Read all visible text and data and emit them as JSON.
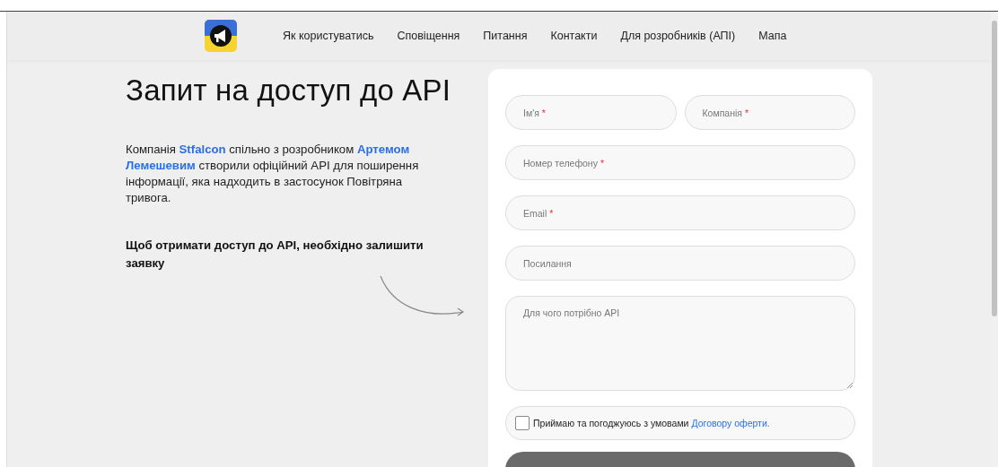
{
  "nav": {
    "items": [
      {
        "label": "Як користуватись"
      },
      {
        "label": "Сповіщення"
      },
      {
        "label": "Питання"
      },
      {
        "label": "Контакти"
      },
      {
        "label": "Для розробників (АПІ)"
      },
      {
        "label": "Мапа"
      }
    ]
  },
  "intro": {
    "title": "Запит на доступ до API",
    "paragraph": "Компанія **Stfalcon** спільно з розробником **Артемом Лемешевим** створили офіційний API для поширення інформації, яка надходить в застосунок Повітряна тривога.",
    "note": "Щоб отримати доступ до API, необхідно залишити заявку"
  },
  "form": {
    "fields": [
      {
        "kind": "half",
        "placeholder": "Ім'я",
        "mark": "*"
      },
      {
        "kind": "half",
        "placeholder": "Компанія",
        "mark": "*"
      },
      {
        "kind": "full",
        "placeholder": "Номер телефону",
        "mark": "*"
      },
      {
        "kind": "full",
        "placeholder": "Email",
        "mark": "*"
      },
      {
        "kind": "full",
        "placeholder": "Посилання"
      },
      {
        "kind": "area",
        "placeholder": "Для чого потрібно API"
      }
    ],
    "consent": {
      "checked": false,
      "text": "Приймаю та погоджуюсь з умовами",
      "link": "Договору оферти."
    }
  }
}
